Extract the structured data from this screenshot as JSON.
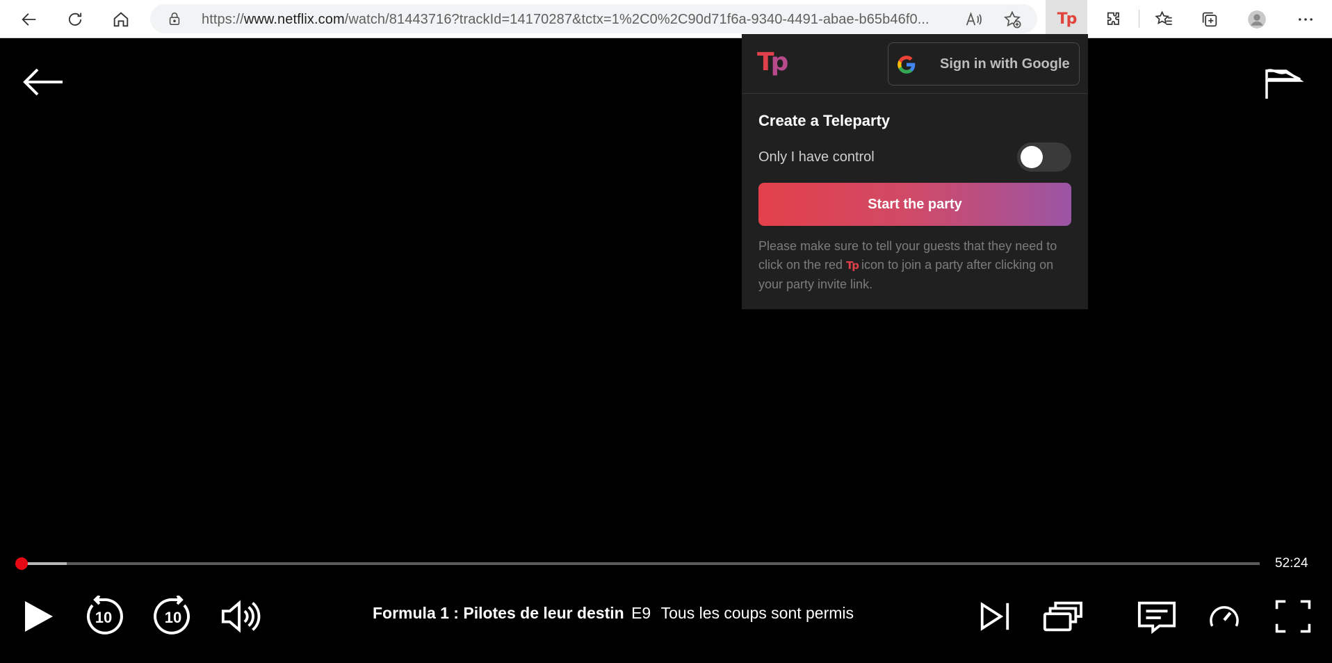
{
  "browser": {
    "url_prefix": "https://",
    "url_domain": "www.netflix.com",
    "url_rest": "/watch/81443716?trackId=14170287&tctx=1%2C0%2C90d71f6a-9340-4491-abae-b65b46f0...",
    "extension_label": "Tp"
  },
  "player": {
    "duration_remaining": "52:24",
    "progress_fraction": 0.004,
    "buffered_fraction": 0.04,
    "show_title": "Formula 1 : Pilotes de leur destin",
    "episode_code": "E9",
    "episode_title": "Tous les coups sont permis",
    "rewind_seconds": "10",
    "forward_seconds": "10"
  },
  "teleparty": {
    "logo_t": "T",
    "logo_p": "p",
    "google_button": "Sign in with Google",
    "heading": "Create a Teleparty",
    "control_label": "Only I have control",
    "control_enabled": false,
    "start_button": "Start the party",
    "note_before": "Please make sure to tell your guests that they need to click on the red ",
    "note_icon": "Tp",
    "note_after": " icon to join a party after clicking on your party invite link."
  },
  "colors": {
    "netflix_red": "#e50914",
    "teleparty_red": "#e0404a",
    "teleparty_purple": "#9b55a5"
  }
}
